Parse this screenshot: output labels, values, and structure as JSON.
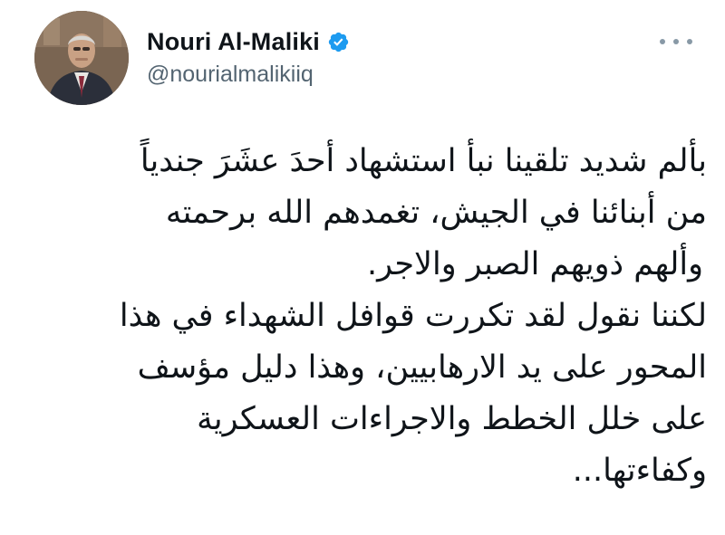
{
  "tweet": {
    "author": {
      "display_name": "Nouri Al-Maliki",
      "handle": "@nourialmalikiiq",
      "verified": true
    },
    "more_icon": "more-horizontal-icon",
    "text_lines": [
      "بألم شديد تلقينا نبأ استشهاد أحدَ عشَرَ جندياً",
      "من أبنائنا في الجيش، تغمدهم الله برحمته",
      "وألهم ذويهم الصبر والاجر.",
      "لكننا نقول لقد تكررت قوافل الشهداء في هذا",
      "المحور على يد الارهابيين، وهذا دليل مؤسف",
      "على خلل الخطط والاجراءات العسكرية",
      "وكفاءتها..."
    ]
  },
  "colors": {
    "text": "#0f1419",
    "secondary_text": "#536471",
    "verified_badge": "#1d9bf0",
    "background": "#ffffff"
  }
}
